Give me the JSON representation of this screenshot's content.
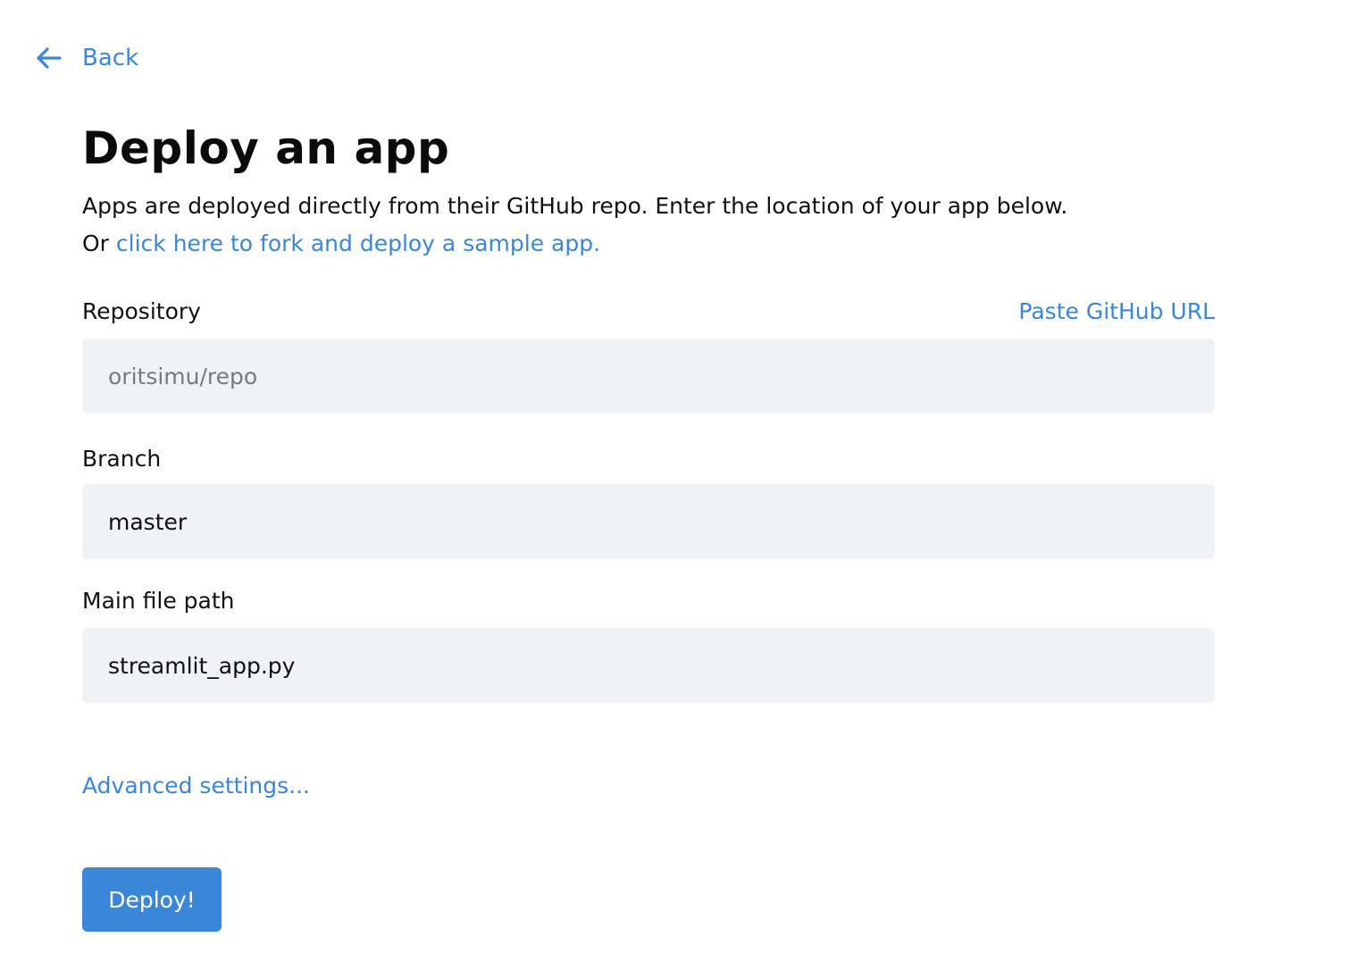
{
  "nav": {
    "back_label": "Back",
    "back_icon": "arrow-left-icon"
  },
  "header": {
    "title": "Deploy an app",
    "description": "Apps are deployed directly from their GitHub repo. Enter the location of your app below.",
    "fork_prefix": "Or ",
    "fork_link": "click here to fork and deploy a sample app."
  },
  "form": {
    "repository": {
      "label": "Repository",
      "paste_link": "Paste GitHub URL",
      "value": "",
      "placeholder": "oritsimu/repo"
    },
    "branch": {
      "label": "Branch",
      "value": "master"
    },
    "main_file_path": {
      "label": "Main file path",
      "value": "streamlit_app.py"
    },
    "advanced_settings_label": "Advanced settings...",
    "deploy_label": "Deploy!"
  },
  "colors": {
    "accent": "#3a86d9",
    "input_background": "#f0f2f6",
    "text": "#111111"
  }
}
